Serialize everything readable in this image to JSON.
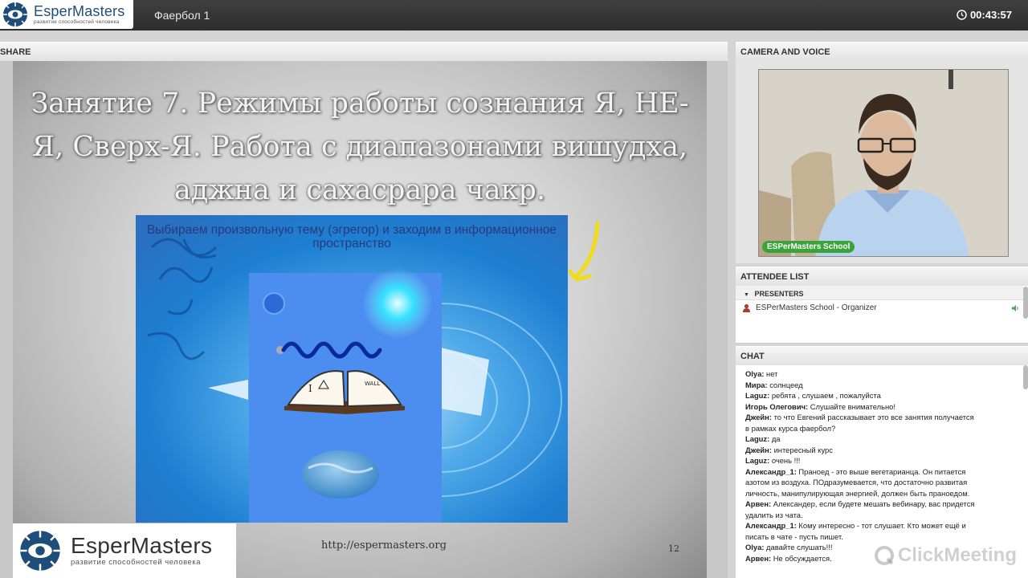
{
  "header": {
    "logo_name": "EsperMasters",
    "logo_sub": "развитие способностей человека",
    "meeting_title": "Фаербол 1",
    "timer": "00:43:57"
  },
  "share": {
    "header": "SHARE",
    "slide": {
      "title": "Занятие 7. Режимы работы сознания Я, НЕ-Я, Сверх-Я. Работа с диапазонами вишудха, аджна и сахасрара чакр.",
      "image_caption": "Выбираем произвольную тему (эгрегор) и заходим в информационное пространство",
      "book_label": "WALL",
      "footer_url": "http://espermasters.org",
      "page_number": "12",
      "logo_name": "EsperMasters",
      "logo_sub": "развитие способностей человека"
    }
  },
  "camera": {
    "header": "CAMERA AND VOICE",
    "badge": "ESPerMasters School"
  },
  "attendees": {
    "header": "ATTENDEE LIST",
    "group": "PRESENTERS",
    "presenter": "ESPerMasters School - Organizer"
  },
  "chat": {
    "header": "CHAT",
    "watermark": "ClickMeeting",
    "messages": [
      {
        "author": "Olya:",
        "text": " нет"
      },
      {
        "author": "Мира:",
        "text": " солнцеед"
      },
      {
        "author": "Laguz:",
        "text": " ребята , слушаем , пожалуйста"
      },
      {
        "author": "Игорь Олегович:",
        "text": " Слушайте внимательно!"
      },
      {
        "author": "Джейн:",
        "text": " то что Евгений рассказывает это все занятия получается"
      },
      {
        "author": "",
        "text": "в рамках курса фаербол?"
      },
      {
        "author": "Laguz:",
        "text": " да"
      },
      {
        "author": "Джейн:",
        "text": " интересный курс"
      },
      {
        "author": "Laguz:",
        "text": " очень !!!"
      },
      {
        "author": "Александр_1:",
        "text": " Праноед - это выше вегетарианца. Он питается"
      },
      {
        "author": "",
        "text": "азотом из воздуха. ПОдразумевается, что достаточно развитая"
      },
      {
        "author": "",
        "text": "личность, манипулирующая энергией, должен быть праноедом."
      },
      {
        "author": "Арвен:",
        "text": " Александер, если будете мешать вебинару, вас придется"
      },
      {
        "author": "",
        "text": "удалить из чата."
      },
      {
        "author": "Александр_1:",
        "text": " Кому интересно - тот слушает. Кто может ещё и"
      },
      {
        "author": "",
        "text": "писать в чате - пусть пишет."
      },
      {
        "author": "Olya:",
        "text": " давайте слушать!!!"
      },
      {
        "author": "Арвен:",
        "text": " Не обсуждается."
      }
    ]
  }
}
